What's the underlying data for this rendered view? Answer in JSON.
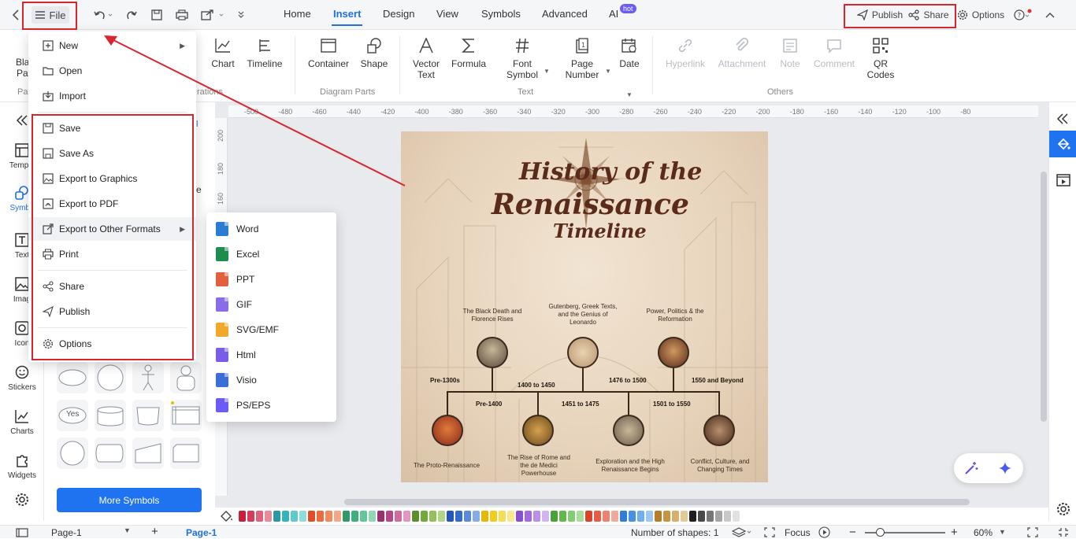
{
  "topbar": {
    "file_label": "File",
    "tabs": [
      "Home",
      "Insert",
      "Design",
      "View",
      "Symbols",
      "Advanced",
      "AI"
    ],
    "hot_badge": "hot",
    "publish": "Publish",
    "share": "Share",
    "options": "Options"
  },
  "ribbon": {
    "partial_left": [
      "Bla",
      "Pa",
      "Pa",
      "rations"
    ],
    "chart": "Chart",
    "timeline": "Timeline",
    "container": "Container",
    "shape": "Shape",
    "vector_text": "Vector\nText",
    "formula": "Formula",
    "font_symbol": "Font\nSymbol",
    "page_number": "Page\nNumber",
    "date": "Date",
    "hyperlink": "Hyperlink",
    "attachment": "Attachment",
    "note": "Note",
    "comment": "Comment",
    "qr_codes": "QR\nCodes",
    "groups": {
      "diagram_parts": "Diagram Parts",
      "text": "Text",
      "others": "Others"
    }
  },
  "rail": {
    "items": [
      "Templa",
      "Symbo",
      "Text",
      "Imag",
      "Icon",
      "Stickers",
      "Charts",
      "Widgets"
    ]
  },
  "symbols_panel": {
    "more_symbols": "More Symbols",
    "yes_label": "Yes",
    "partial_e": "e",
    "partial_l": "l"
  },
  "file_menu": {
    "items": [
      {
        "label": "New",
        "icon": "new-icon",
        "submenu": true
      },
      {
        "label": "Open",
        "icon": "folder-icon"
      },
      {
        "label": "Import",
        "icon": "import-icon"
      },
      {
        "label": "Save",
        "icon": "save-icon"
      },
      {
        "label": "Save As",
        "icon": "save-as-icon"
      },
      {
        "label": "Export to Graphics",
        "icon": "image-icon"
      },
      {
        "label": "Export to PDF",
        "icon": "pdf-icon"
      },
      {
        "label": "Export to Other Formats",
        "icon": "export-icon",
        "submenu": true
      },
      {
        "label": "Print",
        "icon": "print-icon"
      },
      {
        "label": "Share",
        "icon": "share-icon"
      },
      {
        "label": "Publish",
        "icon": "publish-icon"
      },
      {
        "label": "Options",
        "icon": "gear-icon"
      }
    ]
  },
  "export_submenu": {
    "items": [
      {
        "label": "Word",
        "color": "#2b7cd3"
      },
      {
        "label": "Excel",
        "color": "#1e8c4c"
      },
      {
        "label": "PPT",
        "color": "#e0613b"
      },
      {
        "label": "GIF",
        "color": "#8a6be8"
      },
      {
        "label": "SVG/EMF",
        "color": "#f0a92a"
      },
      {
        "label": "Html",
        "color": "#7a5ce8"
      },
      {
        "label": "Visio",
        "color": "#3a6fd8"
      },
      {
        "label": "PS/EPS",
        "color": "#6b5cf6"
      }
    ]
  },
  "ruler": {
    "h_ticks": [
      "-500",
      "-480",
      "-460",
      "-440",
      "-420",
      "-400",
      "-380",
      "-360",
      "-340",
      "-320",
      "-300",
      "-280",
      "-260",
      "-240",
      "-220",
      "-200",
      "-180",
      "-160",
      "-140",
      "-120",
      "-100",
      "-80"
    ],
    "v_ticks": [
      "200",
      "180",
      "160"
    ]
  },
  "infographic": {
    "title_line1": "History of the",
    "title_line2": "Renaissance",
    "title_line3": "Timeline",
    "top_captions": [
      "The Black Death and\nFlorence Rises",
      "Gutenberg, Greek Texts,\nand the Genius of\nLeonardo",
      "Power, Politics & the\nReformation"
    ],
    "upper_dates": [
      "Pre-1300s",
      "1400 to 1450",
      "1476 to 1500",
      "1550 and Beyond"
    ],
    "lower_dates": [
      "Pre-1400",
      "1451 to 1475",
      "1501 to 1550"
    ],
    "bottom_captions": [
      "The Proto-Renaissance",
      "The Rise of Rome and\nthe de Medici\nPowerhouse",
      "Exploration and the High\nRenaissance Begins",
      "Conflict, Culture, and\nChanging Times"
    ]
  },
  "palette": [
    "#c4203a",
    "#d63b57",
    "#e0617a",
    "#e88a9c",
    "#2a9aa3",
    "#38b3bb",
    "#60c8cf",
    "#8fdbe0",
    "#e04d2a",
    "#ec6a3c",
    "#f28a5d",
    "#f6a884",
    "#2e9a6b",
    "#3eb07e",
    "#64c49a",
    "#8fd7b7",
    "#9b2f6f",
    "#b84686",
    "#cf6aa2",
    "#e195bf",
    "#5b8f2a",
    "#74a83a",
    "#93c05a",
    "#b1d684",
    "#2456b8",
    "#336ccf",
    "#5a8ae0",
    "#86abea",
    "#e6b800",
    "#f2cc1a",
    "#f6dc57",
    "#f9e88f",
    "#8a4fd1",
    "#a26ae0",
    "#bb8eea",
    "#d3b4f2",
    "#4aa33a",
    "#5fba4b",
    "#84cd72",
    "#a9dd9d",
    "#d9422b",
    "#e85c43",
    "#ef826e",
    "#f4a899",
    "#2f7ed8",
    "#4593e6",
    "#70aeee",
    "#9bc7f4",
    "#b37d2a",
    "#c79540",
    "#d8b06c",
    "#e6c998",
    "#1f1f1f",
    "#4a4a4a",
    "#777777",
    "#a5a5a5",
    "#c8c8c8",
    "#e2e2e2"
  ],
  "status": {
    "page_select": "Page-1",
    "page_tab": "Page-1",
    "shapes": "Number of shapes: 1",
    "focus": "Focus",
    "zoom": "60%"
  }
}
